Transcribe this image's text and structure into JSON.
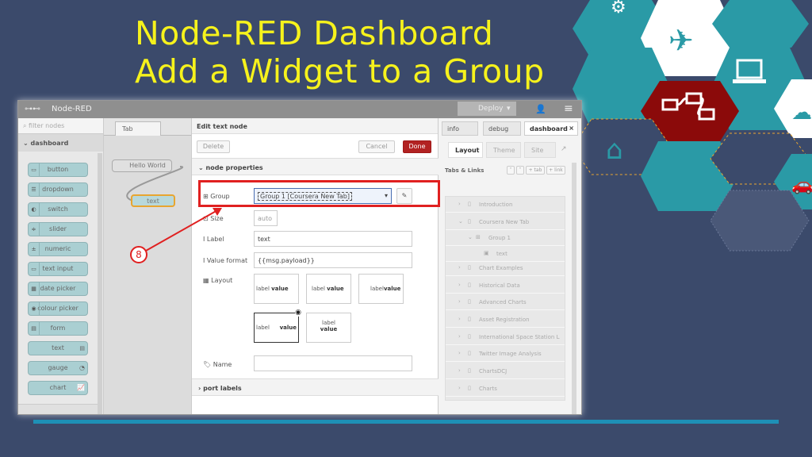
{
  "slide": {
    "title_line1": "Node-RED Dashboard",
    "title_line2": "Add a Widget to a Group",
    "step_number": "8"
  },
  "colors": {
    "background": "#3b4a6b",
    "title": "#f6f21c",
    "hex_teal": "#2a9aa6",
    "hex_white": "#ffffff",
    "hex_red": "#8b0a0a",
    "bottom_bar": "#1e90b6",
    "highlight": "#e02020"
  },
  "header": {
    "app_title": "Node-RED",
    "deploy_label": "Deploy"
  },
  "palette": {
    "filter_placeholder": "filter nodes",
    "category": "dashboard",
    "nodes": [
      "button",
      "dropdown",
      "switch",
      "slider",
      "numeric",
      "text input",
      "date picker",
      "colour picker",
      "form",
      "text",
      "gauge",
      "chart"
    ]
  },
  "workspace": {
    "tab_label": "Tab",
    "nodes": [
      "Hello World",
      "text"
    ]
  },
  "editor": {
    "title": "Edit text node",
    "delete_label": "Delete",
    "cancel_label": "Cancel",
    "done_label": "Done",
    "node_properties_label": "node properties",
    "port_labels_label": "port labels",
    "group_label": "Group",
    "group_value": "Group 1 [Coursera New Tab]",
    "size_label": "Size",
    "size_value": "auto",
    "label_label": "Label",
    "label_value": "text",
    "value_format_label": "Value format",
    "value_format_value": "{{msg.payload}}",
    "layout_label": "Layout",
    "layout_label_word": "label",
    "layout_value_word": "value",
    "name_label": "Name",
    "name_value": ""
  },
  "sidebar": {
    "tabs": [
      "info",
      "debug",
      "dashboard"
    ],
    "subtabs": [
      "Layout",
      "Theme",
      "Site"
    ],
    "tabs_links_label": "Tabs & Links",
    "tab_button": "+ tab",
    "link_button": "+ link",
    "tree": [
      {
        "label": "Introduction",
        "indent": 0,
        "expanded": false
      },
      {
        "label": "Coursera New Tab",
        "indent": 0,
        "expanded": true
      },
      {
        "label": "Group 1",
        "indent": 1,
        "expanded": true
      },
      {
        "label": "text",
        "indent": 2,
        "expanded": false
      },
      {
        "label": "Chart Examples",
        "indent": 0,
        "expanded": false
      },
      {
        "label": "Historical Data",
        "indent": 0,
        "expanded": false
      },
      {
        "label": "Advanced Charts",
        "indent": 0,
        "expanded": false
      },
      {
        "label": "Asset Registration",
        "indent": 0,
        "expanded": false
      },
      {
        "label": "International Space Station L",
        "indent": 0,
        "expanded": false
      },
      {
        "label": "Twitter Image Analysis",
        "indent": 0,
        "expanded": false
      },
      {
        "label": "ChartsDCJ",
        "indent": 0,
        "expanded": false
      },
      {
        "label": "Charts",
        "indent": 0,
        "expanded": false
      }
    ]
  }
}
